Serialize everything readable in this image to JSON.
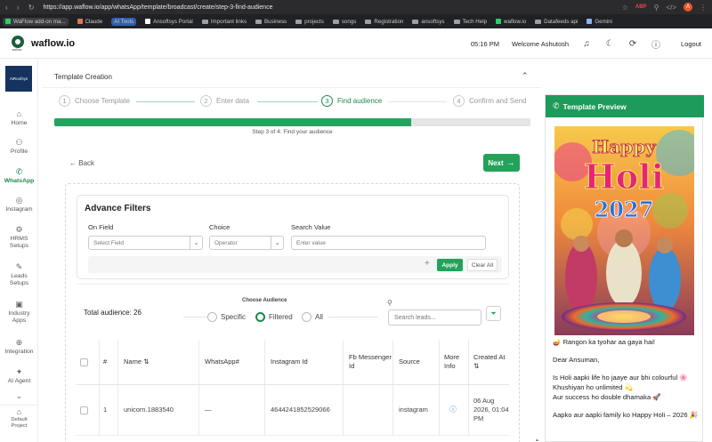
{
  "browser": {
    "url": "https://app.waflow.io/app/whatsApp/template/broadcast/create/step-3-find-audience",
    "avatar_letter": "A",
    "bookmarks": [
      "WaFlow add-on ma...",
      "Claude",
      "AI Tools",
      "Ansoftsys Portal",
      "Important links",
      "Business",
      "projects",
      "songs",
      "Registration",
      "ansoftsys",
      "Tech Help",
      "waflow.io",
      "Datafeeds api",
      "Gemini"
    ],
    "extension_badge": "ABP"
  },
  "header": {
    "brand": "waflow.io",
    "logo_tag": "waflow",
    "time": "05:16 PM",
    "welcome": "Welcome Ashutosh",
    "logout": "Logout"
  },
  "sidebar": {
    "project_logo": "AiRoofsys",
    "items": [
      {
        "label": "Home",
        "icon": "home-icon",
        "glyph": "⌂"
      },
      {
        "label": "Profile",
        "icon": "person-icon",
        "glyph": "⚇"
      },
      {
        "label": "WhatsApp",
        "icon": "whatsapp-icon",
        "glyph": "✆"
      },
      {
        "label": "Instagram",
        "icon": "instagram-icon",
        "glyph": "◎"
      },
      {
        "label": "HRMS Setups",
        "icon": "gear-icon",
        "glyph": "⚙"
      },
      {
        "label": "Leads Setups",
        "icon": "wand-icon",
        "glyph": "✎"
      },
      {
        "label": "Industry Apps",
        "icon": "briefcase-icon",
        "glyph": "▣"
      },
      {
        "label": "Integration",
        "icon": "plug-icon",
        "glyph": "⊕"
      },
      {
        "label": "AI Agent",
        "icon": "sparkle-icon",
        "glyph": "✦"
      }
    ],
    "chevron": "⌄",
    "bottom": {
      "label": "Default Project",
      "icon": "building-icon",
      "glyph": "⌂"
    }
  },
  "main": {
    "title": "Template Creation",
    "steps": [
      {
        "num": "1",
        "label": "Choose Template"
      },
      {
        "num": "2",
        "label": "Enter data"
      },
      {
        "num": "3",
        "label": "Find audience"
      },
      {
        "num": "4",
        "label": "Confirm and Send"
      }
    ],
    "active_step": 3,
    "progress_fraction": 0.75,
    "progress_label": "Step 3 of 4: Find your audience",
    "back": "Back",
    "next": "Next",
    "filters": {
      "title": "Advance Filters",
      "on_field_label": "On Field",
      "on_field_placeholder": "Select Field",
      "choice_label": "Choice",
      "choice_placeholder": "Operator",
      "search_label": "Search Value",
      "search_placeholder": "Enter value",
      "apply": "Apply",
      "clear": "Clear All"
    },
    "audience": {
      "total": "Total audience: 26",
      "choose_label": "Choose Audience",
      "options": [
        "Specific",
        "Filtered",
        "All"
      ],
      "selected": "Filtered",
      "search_placeholder": "Search leads..."
    },
    "table": {
      "headers": [
        "#",
        "Name ⇅",
        "WhatsApp#",
        "Instagram Id",
        "Fb Messenger Id",
        "Source",
        "More Info",
        "Created At ⇅"
      ],
      "rows": [
        {
          "num": "1",
          "name": "unicorn.1883540",
          "whatsapp": "—",
          "instagram": "4644241852529066",
          "fb": "",
          "source": "instagram",
          "created": "06 Aug 2026, 01:04 PM"
        }
      ]
    }
  },
  "preview": {
    "title": "Template Preview",
    "image_text": {
      "line1": "Happy",
      "line2": "Holi",
      "line3": "2027"
    },
    "lines": [
      "🪔 Rangon ka tyohar aa gaya hai!",
      "Dear Ansuman,",
      "Is Holi aapki life ho jaaye aur bhi colourful 🌸",
      "Khushiyan ho unlimited 💫",
      "Aur success ho double dhamaka 🚀",
      "Aapko aur aapki family ko Happy Holi – 2026 🎉"
    ]
  }
}
